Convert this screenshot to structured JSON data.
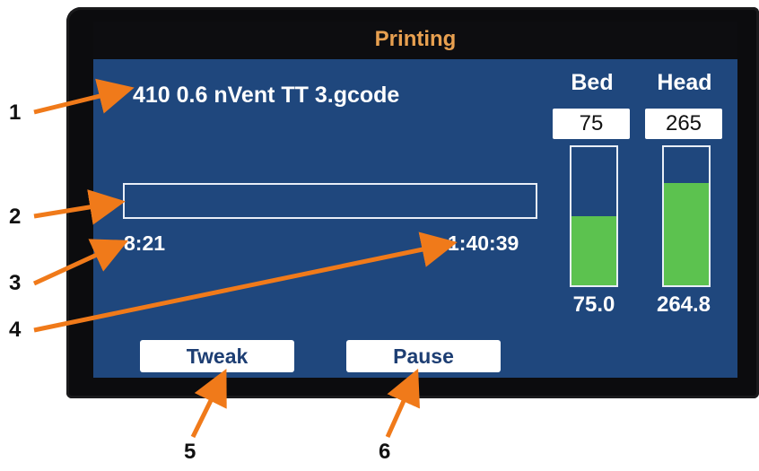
{
  "screen": {
    "title": "Printing",
    "filename": "410 0.6 nVent TT 3.gcode",
    "progress": {
      "fraction": 0.0,
      "elapsed": "8:21",
      "remaining": "1:40:39"
    },
    "bed": {
      "label": "Bed",
      "target": "75",
      "current": "75.0",
      "fill_fraction": 0.5
    },
    "head": {
      "label": "Head",
      "target": "265",
      "current": "264.8",
      "fill_fraction": 0.74
    },
    "buttons": {
      "tweak": "Tweak",
      "pause": "Pause"
    }
  },
  "callouts": [
    "1",
    "2",
    "3",
    "4",
    "5",
    "6"
  ],
  "colors": {
    "screen_bg": "#1f477d",
    "title_text": "#e8a050",
    "bar_fill": "#5cc24f",
    "arrow": "#f07a1a"
  }
}
